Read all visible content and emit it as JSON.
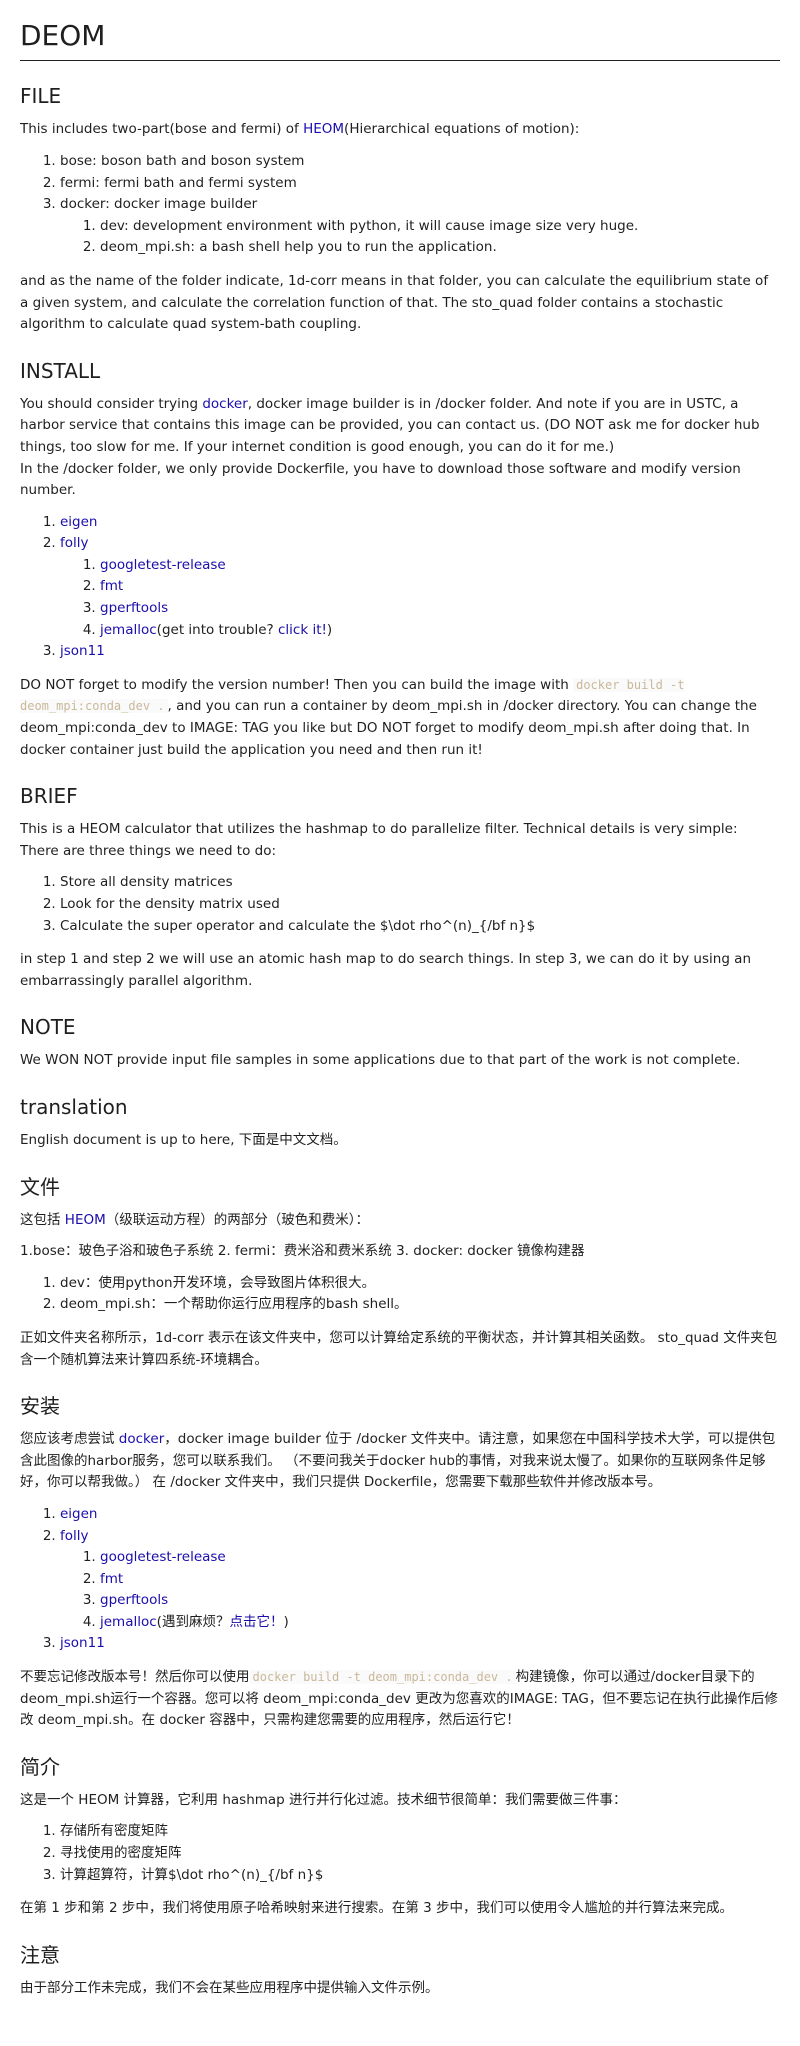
{
  "title": "DEOM",
  "file": {
    "heading": "FILE",
    "intro_pre": "This includes two-part(bose and fermi) of ",
    "intro_link": "HEOM",
    "intro_post": "(Hierarchical equations of motion):",
    "items": [
      "bose: boson bath and boson system",
      "fermi: fermi bath and fermi system",
      "docker: docker image builder"
    ],
    "docker_sub": [
      "dev: development environment with python, it will cause image size very huge.",
      "deom_mpi.sh: a bash shell help you to run the application."
    ],
    "outro": "and as the name of the folder indicate, 1d-corr means in that folder, you can calculate the equilibrium state of a given system, and calculate the correlation function of that. The sto_quad folder contains a stochastic algorithm to calculate quad system-bath coupling."
  },
  "install": {
    "heading": "INSTALL",
    "p1_pre": "You should consider trying ",
    "p1_link": "docker",
    "p1_post": ", docker image builder is in /docker folder. And note if you are in USTC, a harbor service that contains this image can be provided, you can contact us. (DO NOT ask me for docker hub things, too slow for me. If your internet condition is good enough, you can do it for me.)",
    "p2": "In the /docker folder, we only provide Dockerfile, you have to download those software and modify version number.",
    "deps": {
      "eigen": "eigen",
      "folly": "folly",
      "googletest": "googletest-release",
      "fmt": "fmt",
      "gperftools": "gperftools",
      "jemalloc": "jemalloc",
      "jemalloc_note_pre": "(get into trouble? ",
      "jemalloc_note_link": "click it!",
      "jemalloc_note_post": ")",
      "json11": "json11"
    },
    "p3_pre": "DO NOT forget to modify the version number! Then you can build the image with ",
    "p3_code": "docker build -t deom_mpi:conda_dev .",
    "p3_post": ", and you can run a container by deom_mpi.sh in /docker directory. You can change the deom_mpi:conda_dev to IMAGE: TAG you like but DO NOT forget to modify deom_mpi.sh after doing that. In docker container just build the application you need and then run it!"
  },
  "brief": {
    "heading": "BRIEF",
    "p1": "This is a HEOM calculator that utilizes the hashmap to do parallelize filter. Technical details is very simple: There are three things we need to do:",
    "items": [
      "Store all density matrices",
      "Look for the density matrix used",
      "Calculate the super operator and calculate the $\\dot rho^(n)_{/bf n}$"
    ],
    "p2": "in step 1 and step 2 we will use an atomic hash map to do search things. In step 3, we can do it by using an embarrassingly parallel algorithm."
  },
  "note": {
    "heading": "NOTE",
    "p1": "We WON NOT provide input file samples in some applications due to that part of the work is not complete."
  },
  "translation": {
    "heading": "translation",
    "p1": "English document is up to here, 下面是中文文档。"
  },
  "zh_file": {
    "heading": "文件",
    "intro_pre": "这包括 ",
    "intro_link": "HEOM",
    "intro_post": "（级联运动方程）的两部分（玻色和费米）：",
    "line": "1.bose：玻色子浴和玻色子系统 2. fermi：费米浴和费米系统 3. docker: docker 镜像构建器",
    "items": [
      "dev：使用python开发环境，会导致图片体积很大。",
      "deom_mpi.sh：一个帮助你运行应用程序的bash shell。"
    ],
    "outro": "正如文件夹名称所示，1d-corr 表示在该文件夹中，您可以计算给定系统的平衡状态，并计算其相关函数。 sto_quad 文件夹包含一个随机算法来计算四系统-环境耦合。"
  },
  "zh_install": {
    "heading": "安装",
    "p1_pre": "您应该考虑尝试 ",
    "p1_link": "docker",
    "p1_post": "，docker image builder 位于 /docker 文件夹中。请注意，如果您在中国科学技术大学，可以提供包含此图像的harbor服务，您可以联系我们。 （不要问我关于docker hub的事情，对我来说太慢了。如果你的互联网条件足够好，你可以帮我做。） 在 /docker 文件夹中，我们只提供 Dockerfile，您需要下载那些软件并修改版本号。",
    "deps": {
      "eigen": "eigen",
      "folly": "folly",
      "googletest": "googletest-release",
      "fmt": "fmt",
      "gperftools": "gperftools",
      "jemalloc": "jemalloc",
      "jemalloc_note_pre": "(遇到麻烦？",
      "jemalloc_note_link": "点击它！",
      "jemalloc_note_post": ")",
      "json11": "json11"
    },
    "p2_pre": "不要忘记修改版本号！然后你可以使用",
    "p2_code": "docker build -t deom_mpi:conda_dev .",
    "p2_post": "构建镜像，你可以通过/docker目录下的deom_mpi.sh运行一个容器。您可以将 deom_mpi:conda_dev 更改为您喜欢的IMAGE: TAG，但不要忘记在执行此操作后修改 deom_mpi.sh。在 docker 容器中，只需构建您需要的应用程序，然后运行它！"
  },
  "zh_brief": {
    "heading": "简介",
    "p1": "这是一个 HEOM 计算器，它利用 hashmap 进行并行化过滤。技术细节很简单：我们需要做三件事：",
    "items": [
      "存储所有密度矩阵",
      "寻找使用的密度矩阵",
      "计算超算符，计算$\\dot rho^(n)_{/bf n}$"
    ],
    "p2": "在第 1 步和第 2 步中，我们将使用原子哈希映射来进行搜索。在第 3 步中，我们可以使用令人尴尬的并行算法来完成。"
  },
  "zh_note": {
    "heading": "注意",
    "p1": "由于部分工作未完成，我们不会在某些应用程序中提供输入文件示例。"
  }
}
